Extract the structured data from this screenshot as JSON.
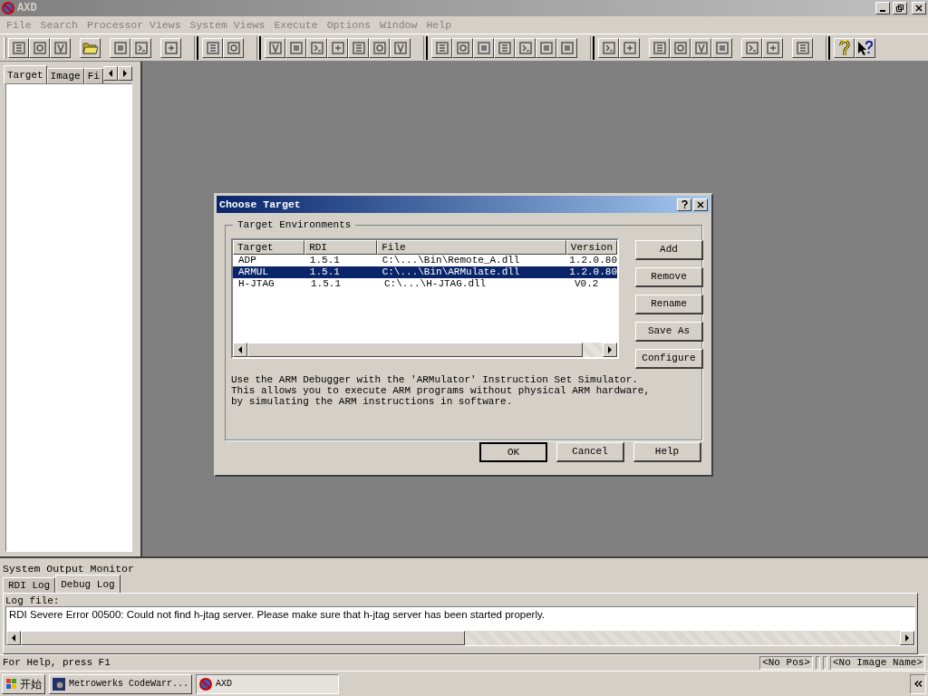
{
  "window": {
    "title": "AXD"
  },
  "menu": [
    "File",
    "Search",
    "Processor Views",
    "System Views",
    "Execute",
    "Options",
    "Window",
    "Help"
  ],
  "left_panel": {
    "tabs": [
      {
        "label": "Target",
        "selected": true
      },
      {
        "label": "Image",
        "selected": false
      },
      {
        "label": "Fi",
        "selected": false
      }
    ]
  },
  "dialog": {
    "title": "Choose Target",
    "group": "Target Environments",
    "table": {
      "columns": [
        "Target",
        "RDI",
        "File",
        "Version"
      ],
      "rows": [
        {
          "cells": [
            "ADP",
            "1.5.1",
            "C:\\...\\Bin\\Remote_A.dll",
            "1.2.0.80"
          ],
          "selected": false
        },
        {
          "cells": [
            "ARMUL",
            "1.5.1",
            "C:\\...\\Bin\\ARMulate.dll",
            "1.2.0.80"
          ],
          "selected": true
        },
        {
          "cells": [
            "H-JTAG",
            "1.5.1",
            "C:\\...\\H-JTAG.dll",
            "V0.2"
          ],
          "selected": false
        }
      ]
    },
    "description": [
      "Use the ARM Debugger with the 'ARMulator' Instruction Set Simulator.",
      "This allows you to execute ARM programs without physical ARM hardware,",
      "by simulating the ARM instructions in software."
    ],
    "side_buttons": [
      "Add",
      "Remove",
      "Rename",
      "Save As",
      "Configure"
    ],
    "buttons": [
      {
        "label": "OK",
        "default": true
      },
      {
        "label": "Cancel",
        "default": false
      },
      {
        "label": "Help",
        "default": false
      }
    ]
  },
  "output_monitor": {
    "title": "System Output Monitor",
    "tabs": [
      {
        "label": "RDI Log",
        "selected": false
      },
      {
        "label": "Debug Log",
        "selected": true
      }
    ],
    "log_label": "Log file:",
    "log": "RDI Severe Error 00500: Could not find h-jtag server. Please make sure that h-jtag server has been started properly."
  },
  "status_bar": {
    "text": "For Help, press F1",
    "panes": [
      "<No Pos>",
      "<No Image Name>"
    ]
  },
  "taskbar": {
    "start": "开始",
    "tasks": [
      {
        "label": "Metrowerks CodeWarr...",
        "selected": false
      },
      {
        "label": "AXD",
        "selected": true
      }
    ]
  }
}
